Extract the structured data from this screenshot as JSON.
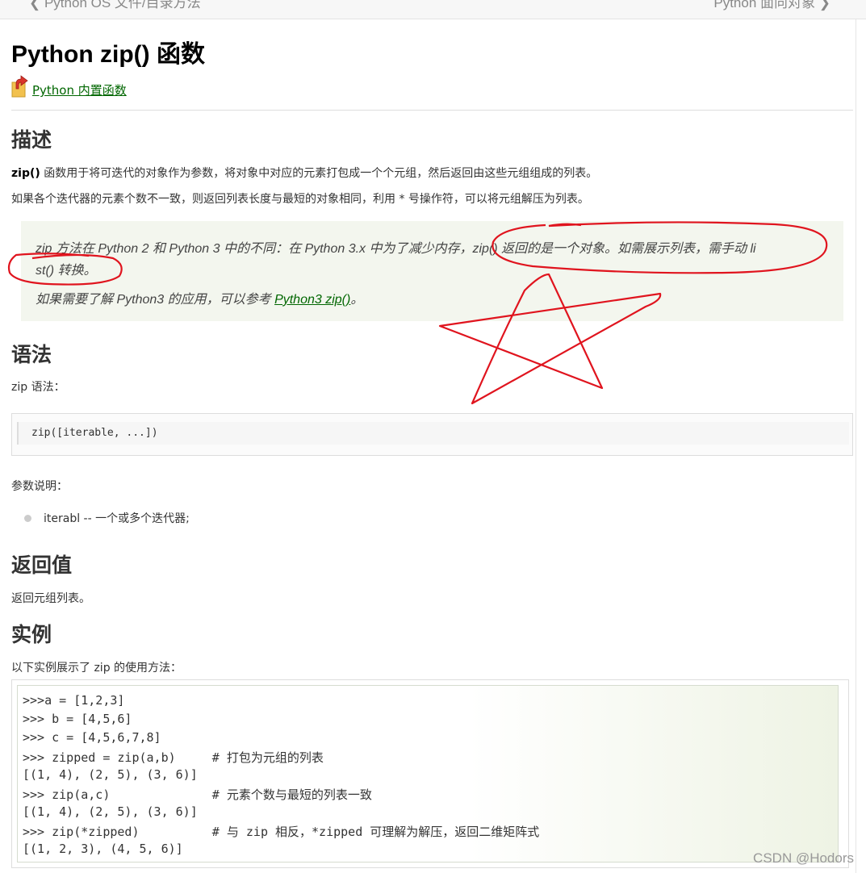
{
  "nav": {
    "prev_label": "Python OS 文件/目录方法",
    "next_label": "Python 面向对象"
  },
  "page_title": "Python zip() 函数",
  "category_link": "Python 内置函数",
  "desc": {
    "heading": "描述",
    "p1_bold": "zip()",
    "p1_rest": " 函数用于将可迭代的对象作为参数，将对象中对应的元素打包成一个个元组，然后返回由这些元组组成的列表。",
    "p2": "如果各个迭代器的元素个数不一致，则返回列表长度与最短的对象相同，利用 * 号操作符，可以将元组解压为列表。"
  },
  "tip": {
    "line1": "zip 方法在 Python 2 和 Python 3 中的不同：在 Python 3.x 中为了减少内存，zip() 返回的是一个对象。如需展示列表，需手动 li",
    "line2": "st() 转换。",
    "line3_prefix": "如果需要了解 Python3 的应用，可以参考 ",
    "line3_link": "Python3 zip()",
    "line3_suffix": "。"
  },
  "syntax": {
    "heading": "语法",
    "intro": "zip 语法：",
    "code": "zip([iterable, ...])",
    "params_intro": "参数说明：",
    "params": [
      "iterabl -- 一个或多个迭代器;"
    ]
  },
  "return": {
    "heading": "返回值",
    "text": "返回元组列表。"
  },
  "example": {
    "heading": "实例",
    "intro": "以下实例展示了 zip 的使用方法：",
    "lines": [
      ">>>a = [1,2,3]",
      ">>> b = [4,5,6]",
      ">>> c = [4,5,6,7,8]",
      ">>> zipped = zip(a,b)     # 打包为元组的列表",
      "[(1, 4), (2, 5), (3, 6)]",
      ">>> zip(a,c)              # 元素个数与最短的列表一致",
      "[(1, 4), (2, 5), (3, 6)]",
      ">>> zip(*zipped)          # 与 zip 相反，*zipped 可理解为解压，返回二维矩阵式",
      "[(1, 2, 3), (4, 5, 6)]"
    ]
  },
  "watermark": "CSDN @Hodors",
  "colors": {
    "link": "#006600",
    "annotation": "#e0141e",
    "tip_bg": "#f3f6ee"
  }
}
